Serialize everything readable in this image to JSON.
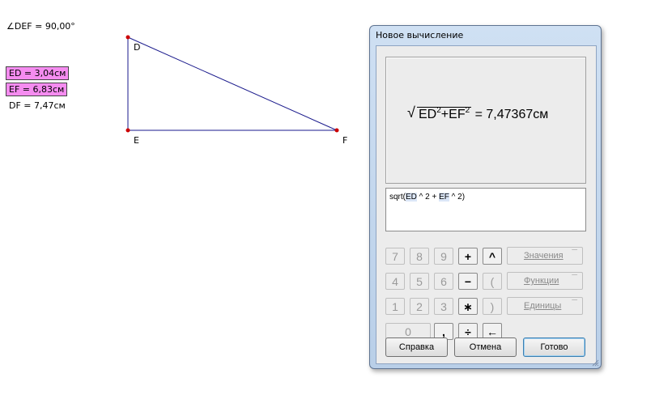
{
  "sketch": {
    "angle_measure": "∠DEF = 90,00°",
    "measures": [
      {
        "text": "ED = 3,04см",
        "highlighted": true
      },
      {
        "text": "EF = 6,83см",
        "highlighted": true
      },
      {
        "text": "DF = 7,47см",
        "highlighted": false
      }
    ],
    "points": {
      "D": "D",
      "E": "E",
      "F": "F"
    },
    "colors": {
      "line": "#1a1a8c",
      "point": "#cc0000",
      "highlight": "#f58cf0"
    }
  },
  "dialog": {
    "title": "Новое вычисление",
    "preview": {
      "radicand_ed": "ED",
      "exp": "2",
      "plus": "+",
      "radicand_ef": "EF",
      "result": "= 7,47367см"
    },
    "editor": {
      "prefix": "sqrt(",
      "tok1": "ED",
      "mid": " ^ 2 + ",
      "tok2": "EF",
      "suffix": " ^ 2)"
    },
    "keypad": {
      "r1": [
        "7",
        "8",
        "9",
        "+",
        "^"
      ],
      "r2": [
        "4",
        "5",
        "6",
        "−",
        "("
      ],
      "r3": [
        "1",
        "2",
        "3",
        "∗",
        ")"
      ],
      "r4": [
        "0",
        ",",
        "÷",
        "←"
      ]
    },
    "dropdowns": {
      "values": "Значения",
      "functions": "Функции",
      "units": "Единицы"
    },
    "buttons": {
      "help": "Справка",
      "cancel": "Отмена",
      "ok": "Готово"
    }
  }
}
